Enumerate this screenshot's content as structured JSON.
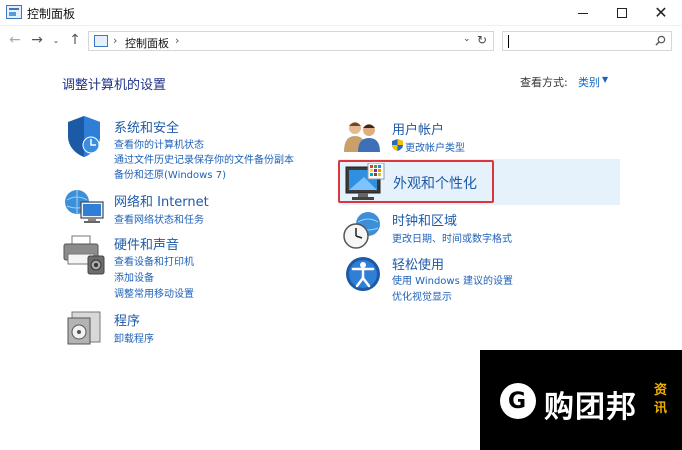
{
  "window": {
    "title": "控制面板",
    "controls": {
      "minimize": "—",
      "maximize": "□",
      "close": "✕"
    }
  },
  "nav": {
    "back": "←",
    "forward": "→",
    "recent": "⌄",
    "up": "↑",
    "address_sep": "›",
    "address_text": "控制面板",
    "address_dropdown": "⌄",
    "refresh": "↻"
  },
  "main": {
    "heading": "调整计算机的设置",
    "view_by_label": "查看方式:",
    "view_by_value": "类别",
    "view_by_caret": "▼"
  },
  "categories": [
    {
      "title": "系统和安全",
      "icon": "shield-icon",
      "links": [
        "查看你的计算机状态",
        "通过文件历史记录保存你的文件备份副本",
        "备份和还原(Windows 7)"
      ]
    },
    {
      "title": "网络和 Internet",
      "icon": "network-globe-icon",
      "links": [
        "查看网络状态和任务"
      ]
    },
    {
      "title": "硬件和声音",
      "icon": "printer-icon",
      "links": [
        "查看设备和打印机",
        "添加设备",
        "调整常用移动设置"
      ]
    },
    {
      "title": "程序",
      "icon": "programs-icon",
      "links": [
        "卸载程序"
      ]
    },
    {
      "title": "用户帐户",
      "icon": "users-icon",
      "links": [
        "更改帐户类型"
      ]
    },
    {
      "title": "外观和个性化",
      "icon": "monitor-palette-icon",
      "links": []
    },
    {
      "title": "时钟和区域",
      "icon": "clock-globe-icon",
      "links": [
        "更改日期、时间或数字格式"
      ]
    },
    {
      "title": "轻松使用",
      "icon": "ease-of-access-icon",
      "links": [
        "使用 Windows 建议的设置",
        "优化视觉显示"
      ]
    }
  ],
  "watermark": {
    "logo_letter": "G",
    "brand": "购团邦",
    "tag1": "资",
    "tag2": "讯"
  },
  "colors": {
    "link": "#1f62b8",
    "heading": "#1e3287",
    "highlight": "#e5f1fb",
    "red_box": "#d9363e",
    "watermark_accent": "#f2b100"
  }
}
